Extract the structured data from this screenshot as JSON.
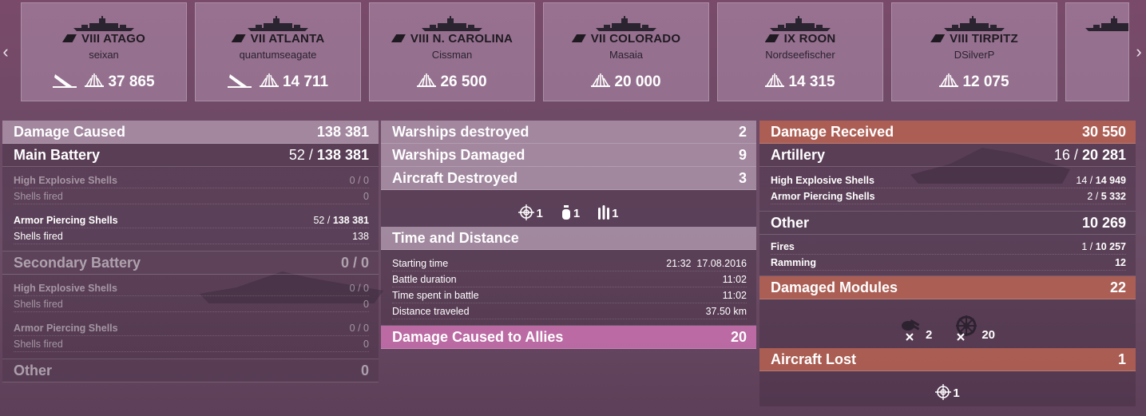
{
  "nav": {
    "left_arrow": "‹",
    "right_arrow": "›"
  },
  "ships": [
    {
      "tier_name": "VIII ATAGO",
      "player": "seixan",
      "damage": "37 865",
      "killed_icon": true
    },
    {
      "tier_name": "VII ATLANTA",
      "player": "quantumseagate",
      "damage": "14 711",
      "killed_icon": true
    },
    {
      "tier_name": "VIII N. CAROLINA",
      "player": "Cissman",
      "damage": "26 500",
      "killed_icon": false
    },
    {
      "tier_name": "VII COLORADO",
      "player": "Masaia",
      "damage": "20 000",
      "killed_icon": false
    },
    {
      "tier_name": "IX ROON",
      "player": "Nordseefischer",
      "damage": "14 315",
      "killed_icon": false
    },
    {
      "tier_name": "VIII TIRPITZ",
      "player": "DSilverP",
      "damage": "12 075",
      "killed_icon": false
    }
  ],
  "damage_caused": {
    "title": "Damage Caused",
    "total": "138 381",
    "main_battery": {
      "label": "Main Battery",
      "hits": "52 /",
      "value": "138 381"
    },
    "mb_he": {
      "label": "High Explosive Shells",
      "value": "0 / 0"
    },
    "mb_he_fired": {
      "label": "Shells fired",
      "value": "0"
    },
    "mb_ap": {
      "label": "Armor Piercing Shells",
      "hits": "52 /",
      "value": "138 381"
    },
    "mb_ap_fired": {
      "label": "Shells fired",
      "value": "138"
    },
    "secondary": {
      "label": "Secondary Battery",
      "value": "0 / 0"
    },
    "sb_he": {
      "label": "High Explosive Shells",
      "value": "0 / 0"
    },
    "sb_he_fired": {
      "label": "Shells fired",
      "value": "0"
    },
    "sb_ap": {
      "label": "Armor Piercing Shells",
      "value": "0 / 0"
    },
    "sb_ap_fired": {
      "label": "Shells fired",
      "value": "0"
    },
    "other": {
      "label": "Other",
      "value": "0"
    }
  },
  "middle": {
    "warships_destroyed": {
      "label": "Warships destroyed",
      "value": "2"
    },
    "warships_damaged": {
      "label": "Warships Damaged",
      "value": "9"
    },
    "aircraft_destroyed": {
      "label": "Aircraft Destroyed",
      "value": "3"
    },
    "aircraft_icons": [
      {
        "icon": "crosshair-icon",
        "count": "1"
      },
      {
        "icon": "bomb-icon",
        "count": "1"
      },
      {
        "icon": "torpedo-icon",
        "count": "1"
      }
    ],
    "time_distance": {
      "title": "Time and Distance",
      "starting_time": {
        "label": "Starting time",
        "value": "21:32  17.08.2016"
      },
      "battle_duration": {
        "label": "Battle duration",
        "value": "11:02"
      },
      "time_spent": {
        "label": "Time spent in battle",
        "value": "11:02"
      },
      "distance": {
        "label": "Distance traveled",
        "value": "37.50 km"
      }
    },
    "allies": {
      "label": "Damage Caused to Allies",
      "value": "20"
    }
  },
  "damage_received": {
    "title": "Damage Received",
    "total": "30 550",
    "artillery": {
      "label": "Artillery",
      "hits": "16 /",
      "value": "20 281"
    },
    "he": {
      "label": "High Explosive Shells",
      "hits": "14 /",
      "value": "14 949"
    },
    "ap": {
      "label": "Armor Piercing Shells",
      "hits": "2 /",
      "value": "5 332"
    },
    "other": {
      "label": "Other",
      "value": "10 269"
    },
    "fires": {
      "label": "Fires",
      "hits": "1 /",
      "value": "10 257"
    },
    "ramming": {
      "label": "Ramming",
      "value": "12"
    },
    "modules": {
      "label": "Damaged Modules",
      "value": "22"
    },
    "module_icons": [
      {
        "icon": "gun-module-icon",
        "count": "2"
      },
      {
        "icon": "steering-module-icon",
        "count": "20"
      }
    ],
    "aircraft_lost": {
      "label": "Aircraft Lost",
      "value": "1"
    },
    "aircraft_lost_icons": [
      {
        "icon": "crosshair-icon",
        "count": "1"
      }
    ]
  }
}
